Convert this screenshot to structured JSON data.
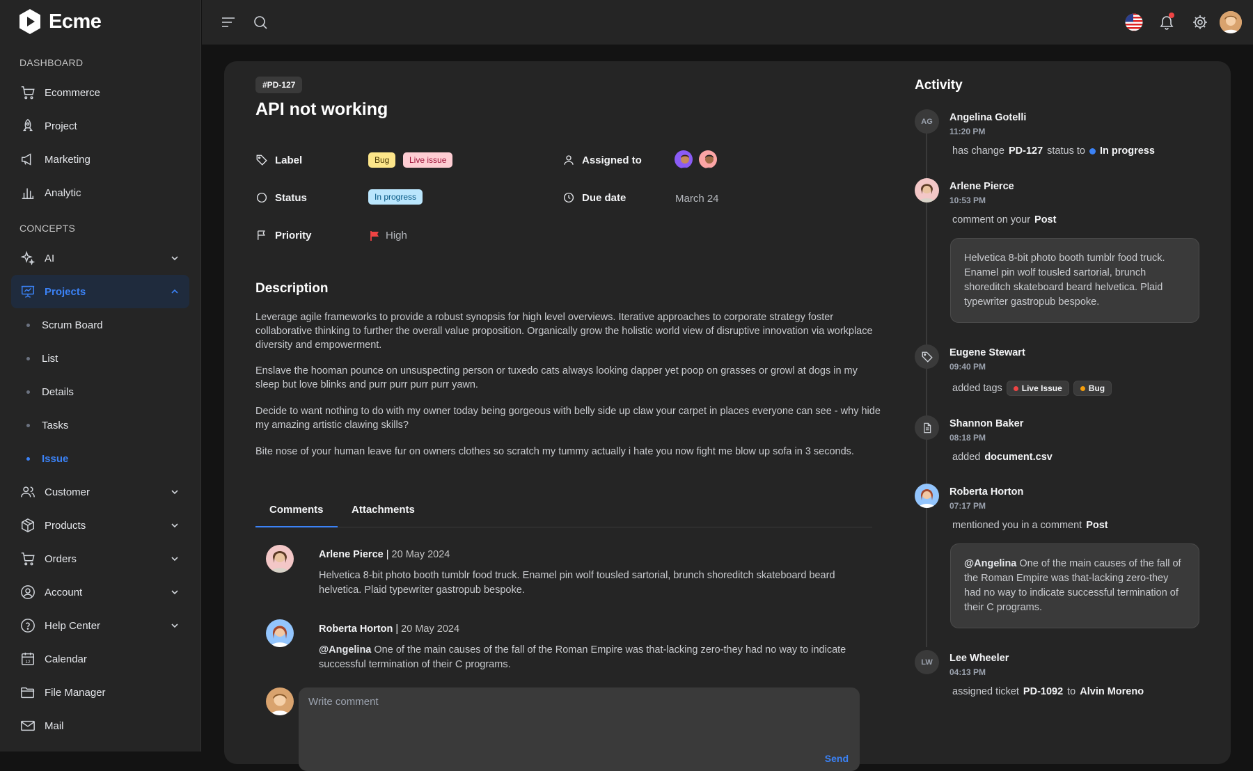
{
  "app": {
    "name": "Ecme"
  },
  "sidebar": {
    "sections": [
      "DASHBOARD",
      "CONCEPTS"
    ],
    "dashboard_items": [
      {
        "label": "Ecommerce",
        "icon": "cart-icon"
      },
      {
        "label": "Project",
        "icon": "rocket-icon"
      },
      {
        "label": "Marketing",
        "icon": "megaphone-icon"
      },
      {
        "label": "Analytic",
        "icon": "bar-chart-icon"
      }
    ],
    "concept_items": [
      {
        "label": "AI",
        "icon": "sparkle-icon"
      },
      {
        "label": "Projects",
        "icon": "presentation-icon"
      },
      {
        "label": "Customer",
        "icon": "users-icon"
      },
      {
        "label": "Products",
        "icon": "box-icon"
      },
      {
        "label": "Orders",
        "icon": "cart-icon"
      },
      {
        "label": "Account",
        "icon": "user-circle-icon"
      },
      {
        "label": "Help Center",
        "icon": "help-icon"
      },
      {
        "label": "Calendar",
        "icon": "calendar-icon"
      },
      {
        "label": "File Manager",
        "icon": "folder-icon"
      },
      {
        "label": "Mail",
        "icon": "mail-icon"
      }
    ],
    "project_sub": [
      "Scrum Board",
      "List",
      "Details",
      "Tasks",
      "Issue"
    ],
    "calendar_day": "12"
  },
  "issue": {
    "id": "#PD-127",
    "title": "API not working",
    "label_title": "Label",
    "labels": [
      "Bug",
      "Live issue"
    ],
    "status_title": "Status",
    "status": "In progress",
    "priority_title": "Priority",
    "priority": "High",
    "assigned_title": "Assigned to",
    "due_title": "Due date",
    "due": "March 24",
    "description_title": "Description",
    "description": [
      "Leverage agile frameworks to provide a robust synopsis for high level overviews. Iterative approaches to corporate strategy foster collaborative thinking to further the overall value proposition. Organically grow the holistic world view of disruptive innovation via workplace diversity and empowerment.",
      "Enslave the hooman pounce on unsuspecting person or tuxedo cats always looking dapper yet poop on grasses or growl at dogs in my sleep but love blinks and purr purr purr purr yawn.",
      "Decide to want nothing to do with my owner today being gorgeous with belly side up claw your carpet in places everyone can see - why hide my amazing artistic clawing skills?",
      "Bite nose of your human leave fur on owners clothes so scratch my tummy actually i hate you now fight me blow up sofa in 3 seconds."
    ],
    "tabs": [
      "Comments",
      "Attachments"
    ],
    "comments": [
      {
        "name": "Arlene Pierce",
        "date": "20 May 2024",
        "mention": "",
        "text": "Helvetica 8-bit photo booth tumblr food truck. Enamel pin wolf tousled sartorial, brunch shoreditch skateboard beard helvetica. Plaid typewriter gastropub bespoke."
      },
      {
        "name": "Roberta Horton",
        "date": "20 May 2024",
        "mention": "@Angelina",
        "text": "One of the main causes of the fall of the Roman Empire was that-lacking zero-they had no way to indicate successful termination of their C programs."
      }
    ],
    "write_placeholder": "Write comment",
    "send_label": "Send"
  },
  "activity": {
    "title": "Activity",
    "items": [
      {
        "initials": "AG",
        "name": "Angelina Gotelli",
        "time": "11:20 PM",
        "pre": "has change",
        "ref": "PD-127",
        "mid": "status to",
        "status": "In progress"
      },
      {
        "name": "Arlene Pierce",
        "time": "10:53 PM",
        "pre": "comment on your",
        "ref": "Post",
        "bubble": "Helvetica 8-bit photo booth tumblr food truck. Enamel pin wolf tousled sartorial, brunch shoreditch skateboard beard helvetica. Plaid typewriter gastropub bespoke."
      },
      {
        "name": "Eugene Stewart",
        "time": "09:40 PM",
        "pre": "added tags",
        "tags": [
          "Live Issue",
          "Bug"
        ]
      },
      {
        "name": "Shannon Baker",
        "time": "08:18 PM",
        "pre": "added",
        "ref": "document.csv"
      },
      {
        "name": "Roberta Horton",
        "time": "07:17 PM",
        "pre": "mentioned you in a comment",
        "ref": "Post",
        "bubble_mention": "@Angelina",
        "bubble": "One of the main causes of the fall of the Roman Empire was that-lacking zero-they had no way to indicate successful termination of their C programs."
      },
      {
        "initials": "LW",
        "name": "Lee Wheeler",
        "time": "04:13 PM",
        "pre": "assigned ticket",
        "ref": "PD-1092",
        "mid": "to",
        "ref2": "Alvin Moreno"
      }
    ]
  },
  "colors": {
    "accent": "#3b82f6",
    "bug": "#fde68a",
    "live": "#fecdd3",
    "progress": "#bae6fd",
    "flag": "#ef4444"
  }
}
